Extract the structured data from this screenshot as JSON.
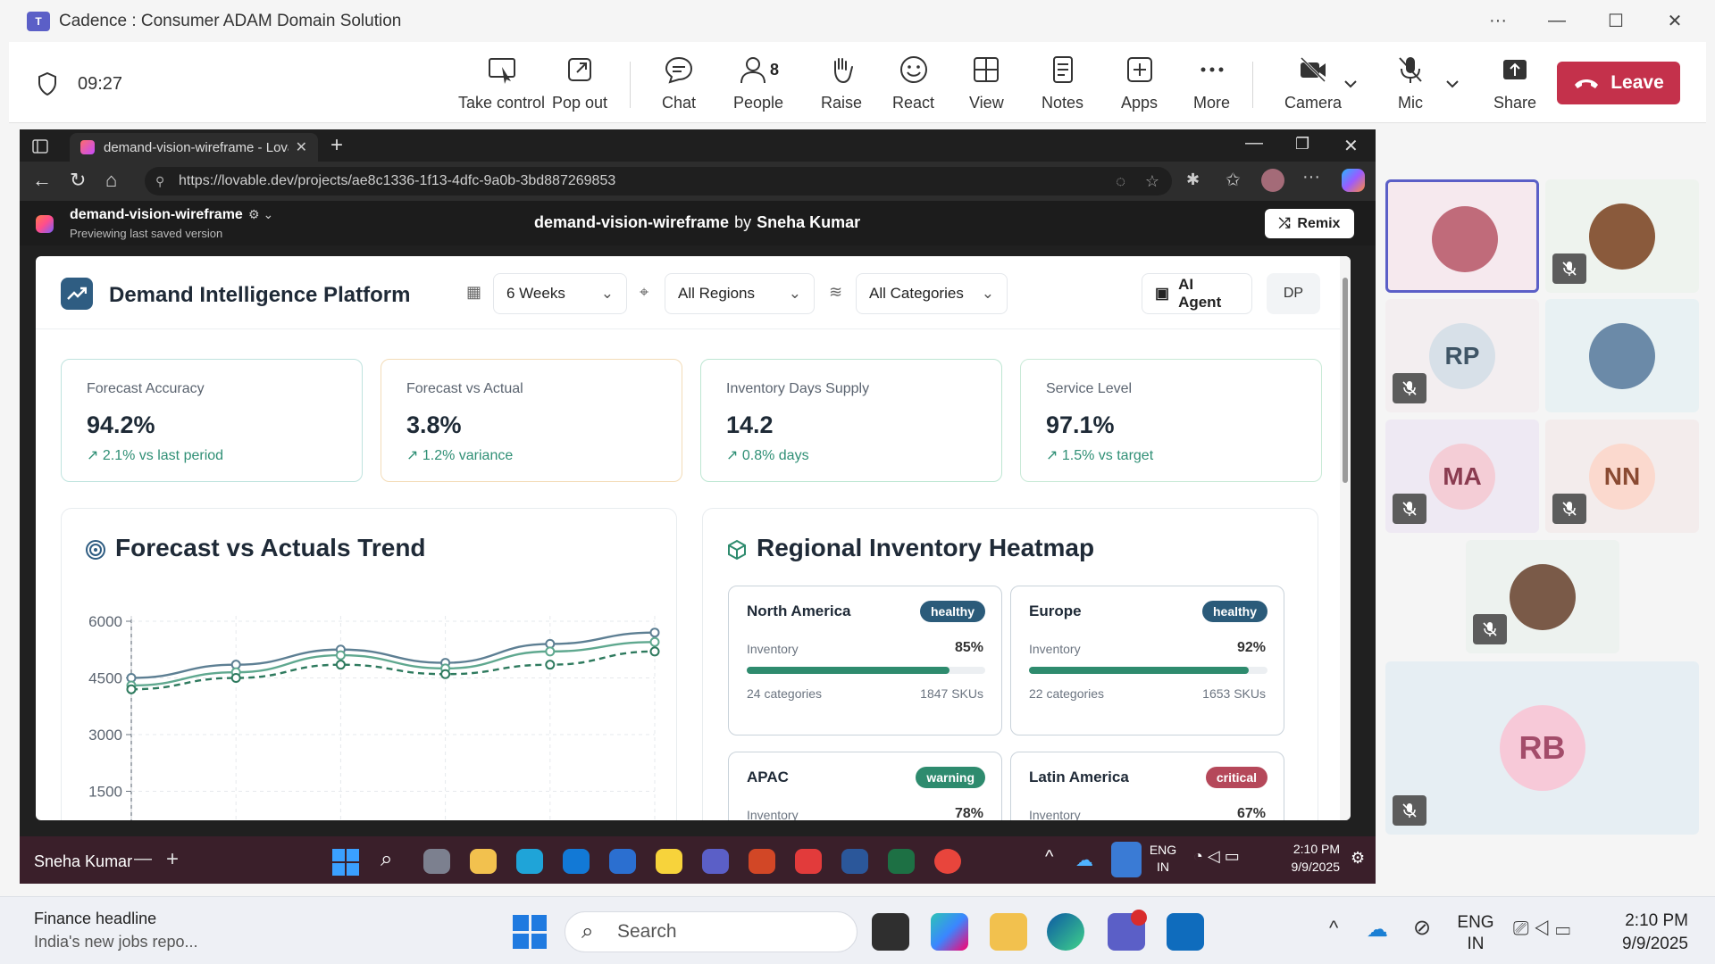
{
  "teams": {
    "window_title": "Cadence : Consumer ADAM Domain Solution",
    "timer": "09:27",
    "toolbar": {
      "take_control": "Take control",
      "pop_out": "Pop out",
      "chat": "Chat",
      "people": "People",
      "people_count": "8",
      "raise": "Raise",
      "react": "React",
      "view": "View",
      "notes": "Notes",
      "apps": "Apps",
      "more": "More",
      "camera": "Camera",
      "mic": "Mic",
      "share": "Share",
      "leave": "Leave"
    }
  },
  "browser": {
    "tab_title": "demand-vision-wireframe - Lovab",
    "url": "https://lovable.dev/projects/ae8c1336-1f13-4dfc-9a0b-3bd887269853",
    "project_name": "demand-vision-wireframe",
    "project_status": "Previewing last saved version",
    "center_title": "demand-vision-wireframe",
    "center_by": "by",
    "center_author": "Sneha Kumar",
    "remix": "Remix"
  },
  "app": {
    "title": "Demand Intelligence Platform",
    "filters": {
      "period": "6 Weeks",
      "region": "All Regions",
      "category": "All Categories"
    },
    "ai_agent": "AI Agent",
    "user_initials": "DP",
    "kpis": [
      {
        "title": "Forecast Accuracy",
        "value": "94.2%",
        "delta": "2.1% vs last period",
        "border": "#bfe3de"
      },
      {
        "title": "Forecast vs Actual",
        "value": "3.8%",
        "delta": "1.2% variance",
        "border": "#f3dcb8"
      },
      {
        "title": "Inventory Days Supply",
        "value": "14.2",
        "delta": "0.8% days",
        "border": "#bde6d2"
      },
      {
        "title": "Service Level",
        "value": "97.1%",
        "delta": "1.5% vs target",
        "border": "#c9ead7"
      }
    ],
    "trend_title": "Forecast vs Actuals Trend",
    "heatmap_title": "Regional Inventory Heatmap",
    "regions": [
      {
        "name": "North America",
        "status": "healthy",
        "status_color": "#2b5b7a",
        "inv_label": "Inventory",
        "pct": "85%",
        "value": 85,
        "categories": "24 categories",
        "skus": "1847 SKUs"
      },
      {
        "name": "Europe",
        "status": "healthy",
        "status_color": "#2b5b7a",
        "inv_label": "Inventory",
        "pct": "92%",
        "value": 92,
        "categories": "22 categories",
        "skus": "1653 SKUs"
      },
      {
        "name": "APAC",
        "status": "warning",
        "status_color": "#2e8b6e",
        "inv_label": "Inventory",
        "pct": "78%",
        "value": 78,
        "categories": "",
        "skus": ""
      },
      {
        "name": "Latin America",
        "status": "critical",
        "status_color": "#b5485a",
        "inv_label": "Inventory",
        "pct": "67%",
        "value": 67,
        "categories": "",
        "skus": ""
      }
    ]
  },
  "chart_data": {
    "type": "line",
    "x": [
      1,
      2,
      3,
      4,
      5,
      6
    ],
    "ylim": [
      0,
      6000
    ],
    "yticks": [
      "6000",
      "4500",
      "3000",
      "1500"
    ],
    "series": [
      {
        "values": [
          4500,
          4850,
          5250,
          4900,
          5400,
          5700
        ],
        "color": "#5d7f93"
      },
      {
        "values": [
          4300,
          4650,
          5100,
          4750,
          5200,
          5450
        ],
        "color": "#5fa88f"
      },
      {
        "values": [
          4200,
          4500,
          4850,
          4600,
          4850,
          5200
        ],
        "color": "#2e7a5e",
        "dashed": true
      }
    ]
  },
  "remote_taskbar": {
    "user": "Sneha Kumar",
    "lang1": "ENG",
    "lang2": "IN",
    "time": "2:10 PM",
    "date": "9/9/2025"
  },
  "participants": [
    {
      "kind": "photo",
      "color": "#c06b7a"
    },
    {
      "kind": "photo",
      "color": "#8a5a3c"
    },
    {
      "kind": "initials",
      "initials": "RP",
      "color": "#d7e0e8",
      "text": "#3f5566"
    },
    {
      "kind": "photo",
      "color": "#6b8aa8"
    },
    {
      "kind": "initials",
      "initials": "MA",
      "color": "#f4cdd6",
      "text": "#8a3b50"
    },
    {
      "kind": "initials",
      "initials": "NN",
      "color": "#fbd9ce",
      "text": "#8a4a32"
    },
    {
      "kind": "photo",
      "color": "#7a5a48"
    },
    {
      "kind": "initials",
      "initials": "RB",
      "color": "#f7c9d8",
      "text": "#a34c6a"
    }
  ],
  "taskbar": {
    "news_title": "Finance headline",
    "news_text": "India's new jobs repo...",
    "search_placeholder": "Search",
    "lang1": "ENG",
    "lang2": "IN",
    "time": "2:10 PM",
    "date": "9/9/2025"
  }
}
